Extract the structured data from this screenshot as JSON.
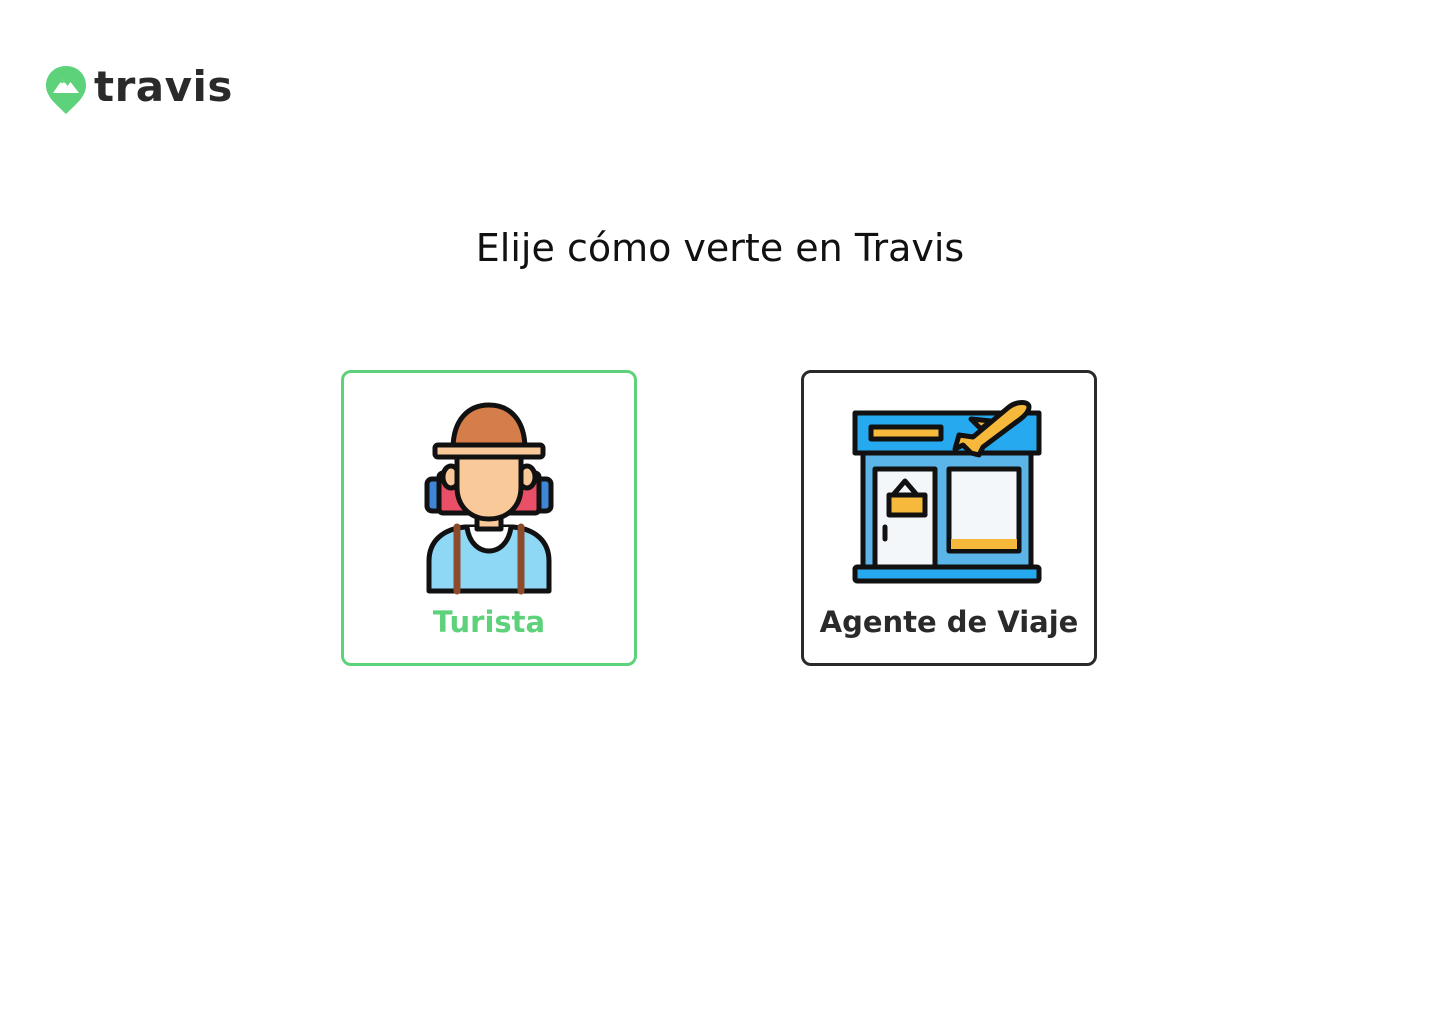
{
  "brand": {
    "name": "travis",
    "logo_icon": "map-pin-mountain-icon",
    "accent_color": "#5dd27a",
    "text_color": "#2a2a2a"
  },
  "main": {
    "title": "Elije cómo verte en Travis",
    "options": [
      {
        "label": "Turista",
        "icon": "backpacker-tourist-icon",
        "selected": true,
        "border_color": "#5dd27a"
      },
      {
        "label": "Agente de Viaje",
        "icon": "travel-agency-storefront-icon",
        "selected": false,
        "border_color": "#2a2a2a"
      }
    ]
  }
}
